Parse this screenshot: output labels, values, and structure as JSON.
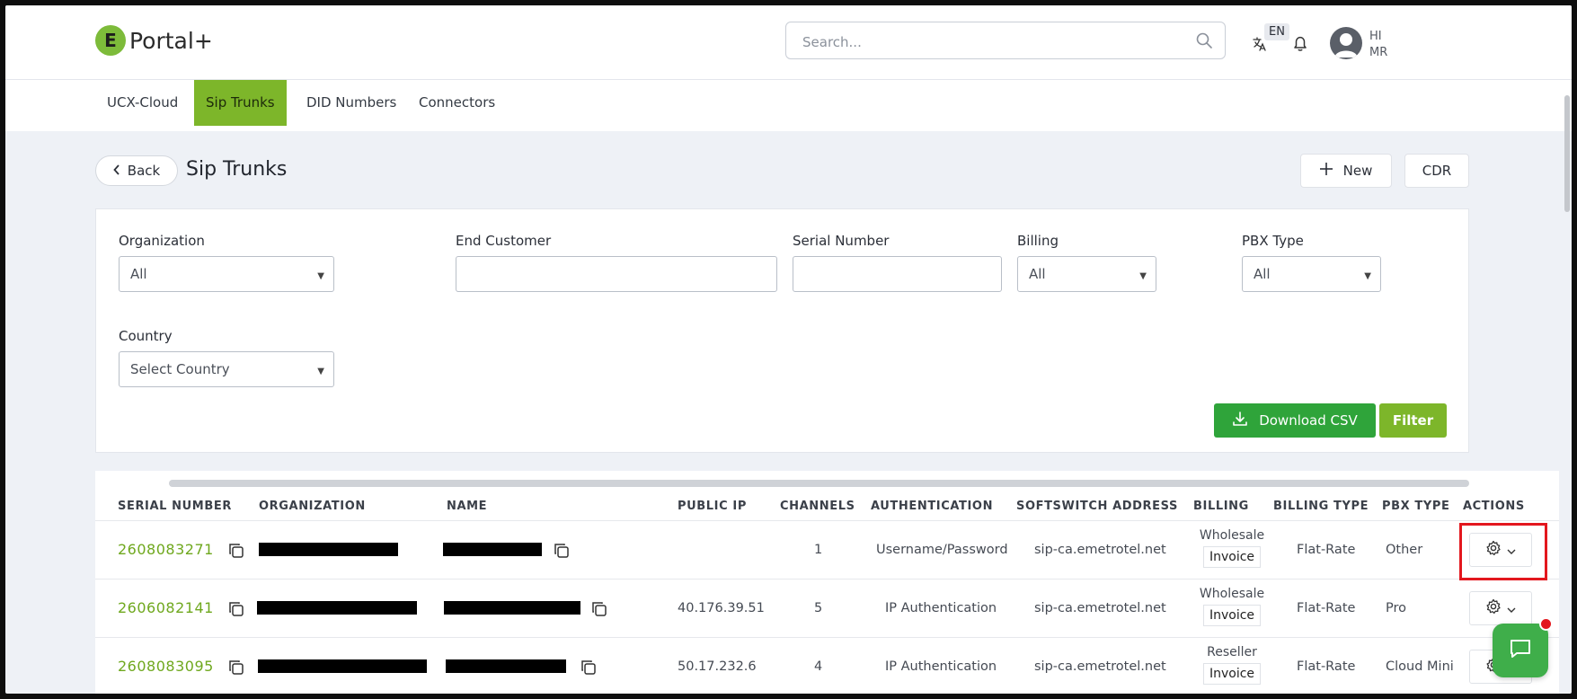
{
  "header": {
    "logo_letter": "E",
    "logo_text": "Portal+",
    "search_placeholder": "Search...",
    "language": "EN",
    "greeting_line1": "HI",
    "greeting_line2": "MR"
  },
  "tabs": [
    {
      "label": "UCX-Cloud",
      "active": false
    },
    {
      "label": "Sip Trunks",
      "active": true
    },
    {
      "label": "DID Numbers",
      "active": false
    },
    {
      "label": "Connectors",
      "active": false
    }
  ],
  "page": {
    "back_label": "Back",
    "title": "Sip Trunks",
    "new_label": "New",
    "cdr_label": "CDR"
  },
  "filters": {
    "organization": {
      "label": "Organization",
      "value": "All"
    },
    "end_customer": {
      "label": "End Customer",
      "value": ""
    },
    "serial_number": {
      "label": "Serial Number",
      "value": ""
    },
    "billing": {
      "label": "Billing",
      "value": "All"
    },
    "pbx_type": {
      "label": "PBX Type",
      "value": "All"
    },
    "country": {
      "label": "Country",
      "value": "Select Country"
    },
    "download_csv_label": "Download CSV",
    "filter_label": "Filter"
  },
  "table": {
    "columns": [
      "SERIAL NUMBER",
      "ORGANIZATION",
      "NAME",
      "PUBLIC IP",
      "CHANNELS",
      "AUTHENTICATION",
      "SOFTSWITCH ADDRESS",
      "BILLING",
      "BILLING TYPE",
      "PBX TYPE",
      "ACTIONS"
    ],
    "rows": [
      {
        "serial": "2608083271",
        "public_ip": "",
        "channels": "1",
        "authentication": "Username/Password",
        "softswitch": "sip-ca.emetrotel.net",
        "billing": "Wholesale",
        "billing_badge": "Invoice",
        "billing_type": "Flat-Rate",
        "pbx_type": "Other"
      },
      {
        "serial": "2606082141",
        "public_ip": "40.176.39.51",
        "channels": "5",
        "authentication": "IP Authentication",
        "softswitch": "sip-ca.emetrotel.net",
        "billing": "Wholesale",
        "billing_badge": "Invoice",
        "billing_type": "Flat-Rate",
        "pbx_type": "Pro"
      },
      {
        "serial": "2608083095",
        "public_ip": "50.17.232.6",
        "channels": "4",
        "authentication": "IP Authentication",
        "softswitch": "sip-ca.emetrotel.net",
        "billing": "Reseller",
        "billing_badge": "Invoice",
        "billing_type": "Flat-Rate",
        "pbx_type": "Cloud Mini"
      }
    ]
  },
  "colors": {
    "brand_green": "#7db62a",
    "serial_green": "#6fa81e",
    "download_green": "#2fa43a",
    "highlight_red": "#e3171e"
  }
}
